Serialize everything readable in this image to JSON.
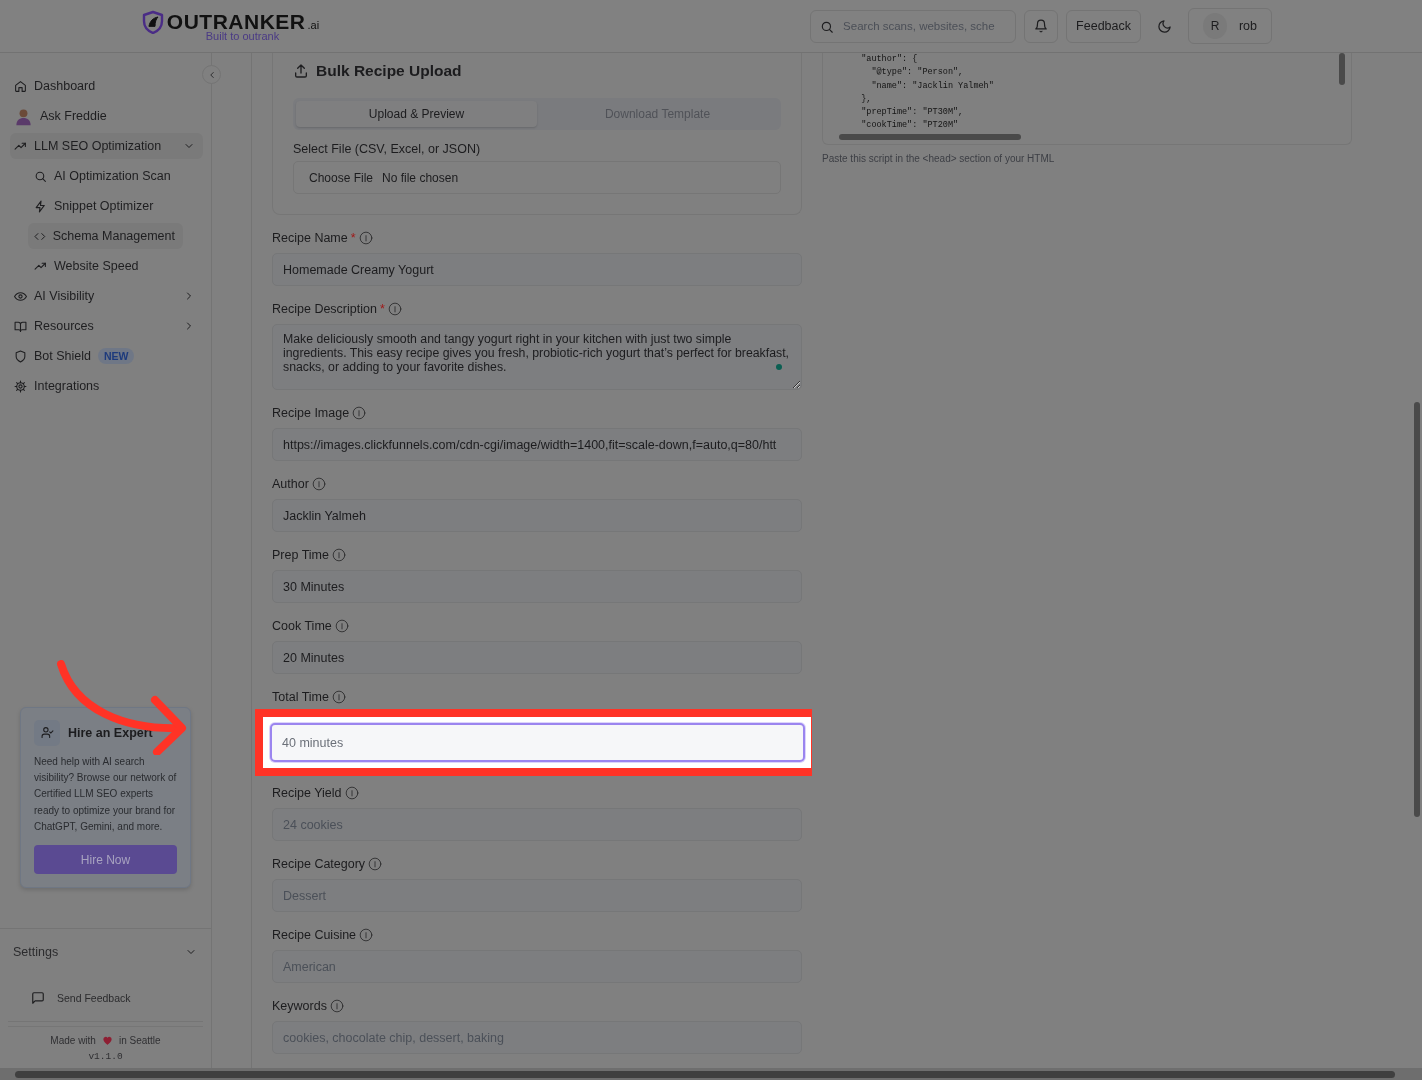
{
  "header": {
    "logo": {
      "name": "OUTRANKER",
      "suffix": ".ai",
      "tagline": "Built to outrank"
    },
    "search": {
      "placeholder": "Search scans, websites, sche"
    },
    "feedback_button": "Feedback",
    "user": {
      "initial": "R",
      "name": "rob"
    }
  },
  "sidebar": {
    "items": [
      {
        "label": "Dashboard",
        "kind": "link",
        "selected": false
      },
      {
        "label": "Ask Freddie",
        "kind": "avatar",
        "selected": false
      },
      {
        "label": "LLM SEO Optimization",
        "kind": "group",
        "selected": true,
        "expanded": true,
        "children": [
          {
            "label": "AI Optimization Scan",
            "selected": false
          },
          {
            "label": "Snippet Optimizer",
            "selected": false
          },
          {
            "label": "Schema Management",
            "selected": true
          },
          {
            "label": "Website Speed",
            "selected": false
          }
        ]
      },
      {
        "label": "AI Visibility",
        "kind": "group",
        "selected": false,
        "expanded": false
      },
      {
        "label": "Resources",
        "kind": "group",
        "selected": false,
        "expanded": false
      },
      {
        "label": "Bot Shield",
        "kind": "link",
        "selected": false,
        "badge": "NEW"
      },
      {
        "label": "Integrations",
        "kind": "link",
        "selected": false
      }
    ],
    "promo": {
      "title": "Hire an Expert",
      "text": "Need help with AI search visibility? Browse our network of Certified LLM SEO experts ready to optimize your brand for ChatGPT, Gemini, and more.",
      "button": "Hire Now"
    },
    "settings": {
      "label": "Settings",
      "expanded": false
    },
    "send_feedback": "Send Feedback",
    "footer": {
      "before": "Made with",
      "after": "in Seattle",
      "version": "v1.1.0"
    }
  },
  "bulk_upload": {
    "title": "Bulk Recipe Upload",
    "tabs": [
      {
        "label": "Upload & Preview",
        "selected": true
      },
      {
        "label": "Download Template",
        "selected": false
      }
    ],
    "file_label": "Select File (CSV, Excel, or JSON)",
    "choose_button": "Choose File",
    "file_status": "No file chosen"
  },
  "fields": [
    {
      "label": "Recipe Name",
      "required_mark": "*",
      "kind": "input",
      "value": "Homemade Creamy Yogurt",
      "focused": false
    },
    {
      "label": "Recipe Description",
      "required_mark": "*",
      "kind": "textarea",
      "value": "Make deliciously smooth and tangy yogurt right in your kitchen with just two simple ingredients. This easy recipe gives you fresh, probiotic-rich yogurt that’s perfect for breakfast, snacks, or adding to your favorite dishes.",
      "focused": false
    },
    {
      "label": "Recipe Image",
      "kind": "input",
      "value": "https://images.clickfunnels.com/cdn-cgi/image/width=1400,fit=scale-down,f=auto,q=80/htt",
      "focused": false
    },
    {
      "label": "Author",
      "kind": "input",
      "value": "Jacklin Yalmeh",
      "focused": false
    },
    {
      "label": "Prep Time",
      "kind": "input",
      "value": "30 Minutes",
      "focused": false
    },
    {
      "label": "Cook Time",
      "kind": "input",
      "value": "20 Minutes",
      "focused": false
    },
    {
      "label": "Total Time",
      "kind": "input",
      "placeholder": "40 minutes",
      "focused": true
    },
    {
      "label": "Recipe Yield",
      "kind": "input",
      "placeholder": "24 cookies",
      "focused": false
    },
    {
      "label": "Recipe Category",
      "kind": "input",
      "placeholder": "Dessert",
      "focused": false
    },
    {
      "label": "Recipe Cuisine",
      "kind": "input",
      "placeholder": "American",
      "focused": false
    },
    {
      "label": "Keywords",
      "kind": "input",
      "placeholder": "cookies, chocolate chip, dessert, baking",
      "focused": false
    }
  ],
  "schema_panel": {
    "code_lines": [
      "  \"author\": {",
      "    \"@type\": \"Person\",",
      "    \"name\": \"Jacklin Yalmeh\"",
      "  },",
      "  \"prepTime\": \"PT30M\",",
      "  \"cookTime\": \"PT20M\""
    ],
    "caption": "Paste this script in the <head> section of your HTML"
  }
}
